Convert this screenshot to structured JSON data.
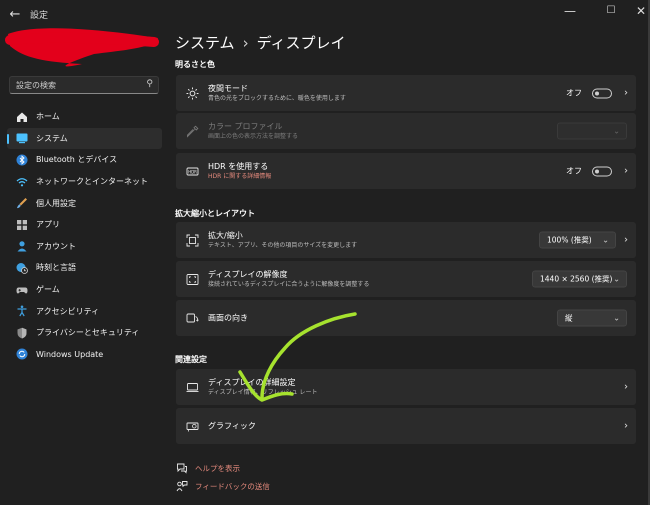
{
  "titlebar": {
    "back_icon": "back-arrow-icon",
    "app_title": "設定",
    "minimize": "—",
    "maximize": "☐",
    "close": "✕"
  },
  "sidebar": {
    "search_placeholder": "設定の検索",
    "items": [
      {
        "label": "ホーム",
        "icon": "home-icon"
      },
      {
        "label": "システム",
        "icon": "system-icon",
        "active": true
      },
      {
        "label": "Bluetooth とデバイス",
        "icon": "bluetooth-icon"
      },
      {
        "label": "ネットワークとインターネット",
        "icon": "wifi-icon"
      },
      {
        "label": "個人用設定",
        "icon": "brush-icon"
      },
      {
        "label": "アプリ",
        "icon": "apps-icon"
      },
      {
        "label": "アカウント",
        "icon": "account-icon"
      },
      {
        "label": "時刻と言語",
        "icon": "time-language-icon"
      },
      {
        "label": "ゲーム",
        "icon": "gamepad-icon"
      },
      {
        "label": "アクセシビリティ",
        "icon": "accessibility-icon"
      },
      {
        "label": "プライバシーとセキュリティ",
        "icon": "shield-icon"
      },
      {
        "label": "Windows Update",
        "icon": "update-icon"
      }
    ]
  },
  "main": {
    "breadcrumb": {
      "parent": "システム",
      "separator": "›",
      "current": "ディスプレイ"
    },
    "sections": {
      "brightness": "明るさと色",
      "scale_layout": "拡大縮小とレイアウト",
      "related": "関連設定"
    },
    "night_light": {
      "title": "夜間モード",
      "subtitle": "青色の光をブロックするために、暖色を使用します",
      "toggle_label": "オフ"
    },
    "color_profile": {
      "title": "カラー プロファイル",
      "subtitle": "画面上の色の表示方法を調整する",
      "value": ""
    },
    "hdr": {
      "title": "HDR を使用する",
      "subtitle": "HDR に関する詳細情報",
      "toggle_label": "オフ"
    },
    "scale": {
      "title": "拡大/縮小",
      "subtitle": "テキスト、アプリ、その他の項目のサイズを変更します",
      "value": "100% (推奨)"
    },
    "resolution": {
      "title": "ディスプレイの解像度",
      "subtitle": "接続されているディスプレイに合うように解像度を調整する",
      "value": "1440 × 2560 (推奨)"
    },
    "orientation": {
      "title": "画面の向き",
      "value": "縦"
    },
    "advanced": {
      "title": "ディスプレイの詳細設定",
      "subtitle": "ディスプレイ情報、リフレッシュ レート"
    },
    "graphics": {
      "title": "グラフィック"
    },
    "help": {
      "get_help": "ヘルプを表示",
      "feedback": "フィードバックの送信"
    }
  },
  "colors": {
    "accent": "#4cc2ff",
    "link": "#e58a7d",
    "background": "#202020",
    "card": "#2b2b2b",
    "redaction": "#e3001b",
    "annotation_arrow": "#a6e22e"
  }
}
